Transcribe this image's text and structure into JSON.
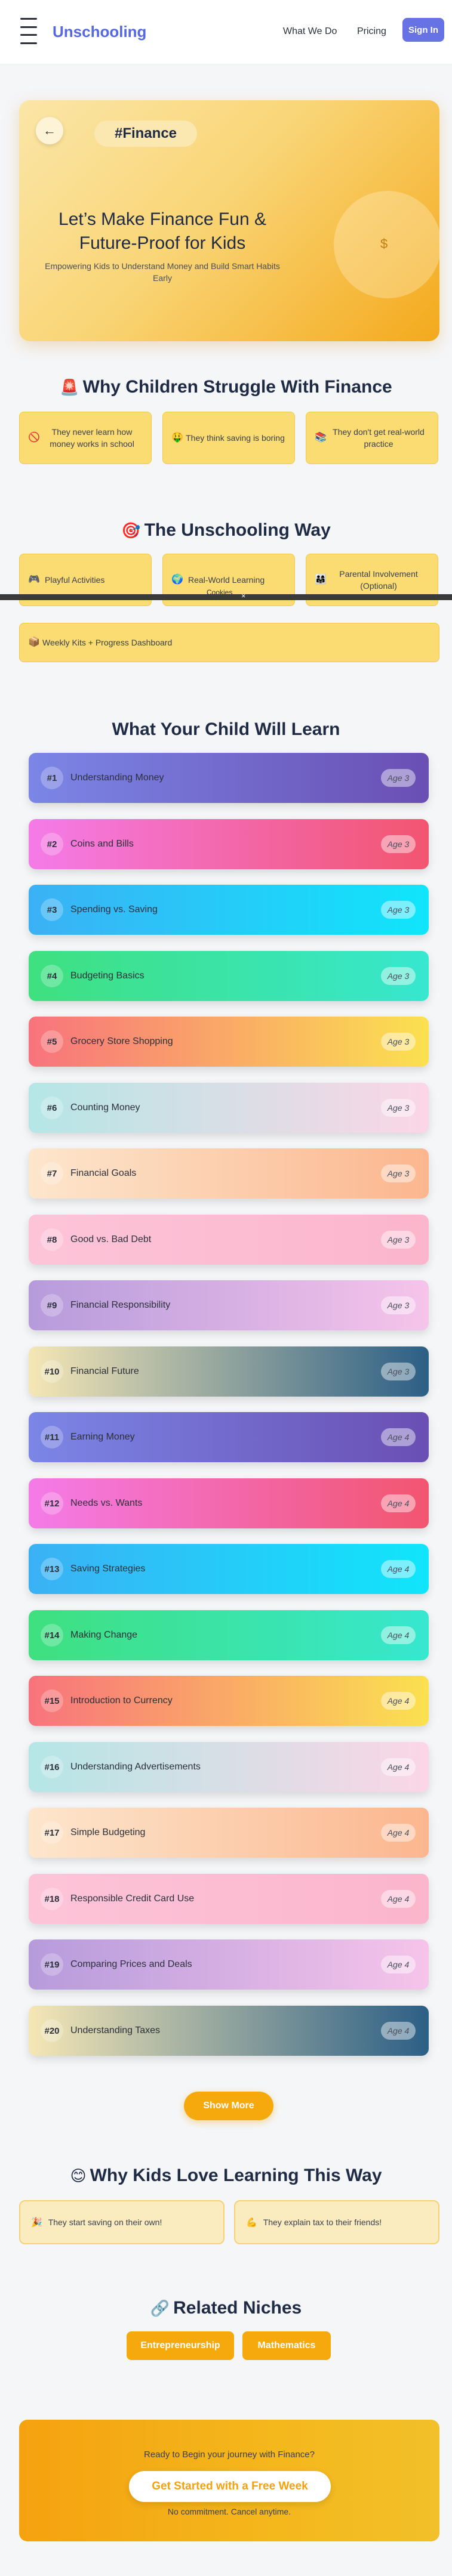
{
  "header": {
    "logo": "Unschooling",
    "nav": [
      "What We Do",
      "Pricing"
    ],
    "signin_label": "Sign In"
  },
  "hero": {
    "back_icon": "arrow-left-icon",
    "tag": "#Finance",
    "title": "Let’s Make Finance Fun & Future-Proof for Kids",
    "subtitle": "Empowering Kids to Understand Money and Build Smart Habits Early",
    "circle_icon": "dollar-icon"
  },
  "struggle": {
    "emoji": "🚨",
    "title": "Why Children Struggle With Finance",
    "cards": [
      {
        "icon": "🚫",
        "text": "They never learn how money works in school"
      },
      {
        "icon": "🤑",
        "text": "They think saving is boring"
      },
      {
        "icon": "📚",
        "text": "They don't get real-world practice"
      }
    ]
  },
  "way": {
    "emoji": "🎯",
    "title": "The Unschooling Way",
    "cards": [
      {
        "icon": "🎮",
        "text": "Playful Activities"
      },
      {
        "icon": "🌍",
        "text": "Real-World Learning"
      },
      {
        "icon": "👨‍👩‍👧",
        "text": "Parental Involvement (Optional)"
      }
    ],
    "wide_card": {
      "icon": "📦",
      "text": "Weekly Kits + Progress Dashboard"
    },
    "overlay_text": "Cookies",
    "overlay_close": "✕"
  },
  "learn": {
    "title": "What Your Child Will Learn",
    "items": [
      {
        "num": "#1",
        "name": "Understanding Money",
        "age": "Age 3"
      },
      {
        "num": "#2",
        "name": "Coins and Bills",
        "age": "Age 3"
      },
      {
        "num": "#3",
        "name": "Spending vs. Saving",
        "age": "Age 3"
      },
      {
        "num": "#4",
        "name": "Budgeting Basics",
        "age": "Age 3"
      },
      {
        "num": "#5",
        "name": "Grocery Store Shopping",
        "age": "Age 3"
      },
      {
        "num": "#6",
        "name": "Counting Money",
        "age": "Age 3"
      },
      {
        "num": "#7",
        "name": "Financial Goals",
        "age": "Age 3"
      },
      {
        "num": "#8",
        "name": "Good vs. Bad Debt",
        "age": "Age 3"
      },
      {
        "num": "#9",
        "name": "Financial Responsibility",
        "age": "Age 3"
      },
      {
        "num": "#10",
        "name": "Financial Future",
        "age": "Age 3"
      },
      {
        "num": "#11",
        "name": "Earning Money",
        "age": "Age 4"
      },
      {
        "num": "#12",
        "name": "Needs vs. Wants",
        "age": "Age 4"
      },
      {
        "num": "#13",
        "name": "Saving Strategies",
        "age": "Age 4"
      },
      {
        "num": "#14",
        "name": "Making Change",
        "age": "Age 4"
      },
      {
        "num": "#15",
        "name": "Introduction to Currency",
        "age": "Age 4"
      },
      {
        "num": "#16",
        "name": "Understanding Advertisements",
        "age": "Age 4"
      },
      {
        "num": "#17",
        "name": "Simple Budgeting",
        "age": "Age 4"
      },
      {
        "num": "#18",
        "name": "Responsible Credit Card Use",
        "age": "Age 4"
      },
      {
        "num": "#19",
        "name": "Comparing Prices and Deals",
        "age": "Age 4"
      },
      {
        "num": "#20",
        "name": "Understanding Taxes",
        "age": "Age 4"
      }
    ],
    "gradients": [
      [
        "#7b86e6",
        "#6a4fb3"
      ],
      [
        "#f47be8",
        "#f2556f"
      ],
      [
        "#3bb1f5",
        "#10e5fb"
      ],
      [
        "#3fe07f",
        "#37e7cf"
      ],
      [
        "#f8737d",
        "#fbe14f"
      ],
      [
        "#b5e6e6",
        "#fbd6e6"
      ],
      [
        "#fde6cc",
        "#fbb68f"
      ],
      [
        "#fdc4d8",
        "#fbb5cc"
      ],
      [
        "#b69bdc",
        "#f6c4ea"
      ],
      [
        "#f5e7b5",
        "#2c5f86"
      ]
    ],
    "show_more": "Show More"
  },
  "love": {
    "emoji": "😊",
    "title": "Why Kids Love Learning This Way",
    "cards": [
      {
        "icon": "🎉",
        "text": "They start saving on their own!"
      },
      {
        "icon": "💪",
        "text": "They explain tax to their friends!"
      }
    ]
  },
  "niches": {
    "emoji": "🔗",
    "title": "Related Niches",
    "items": [
      "Entrepreneurship",
      "Mathematics"
    ]
  },
  "cta": {
    "text": "Ready to Begin your journey with Finance?",
    "button": "Get Started with a Free Week",
    "note": "No commitment. Cancel anytime."
  }
}
